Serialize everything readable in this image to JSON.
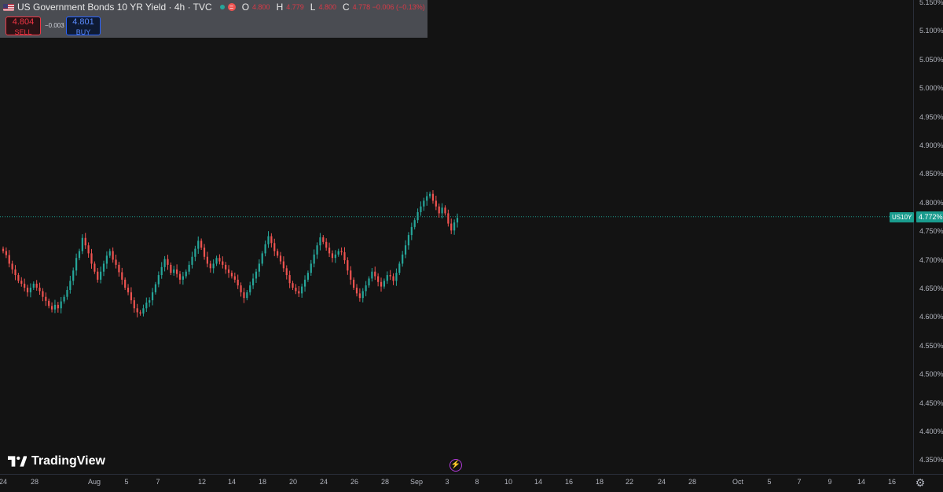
{
  "legend": {
    "symbol_title": "US Government Bonds 10 YR Yield · 4h · TVC",
    "open_key": "O",
    "open_val": "4.800",
    "high_key": "H",
    "high_val": "4.779",
    "low_key": "L",
    "low_val": "4.800",
    "close_key": "C",
    "close_val": "4.778 −0.006 (−0.13%)"
  },
  "trade": {
    "sell_price": "4.804",
    "sell_label": "SELL",
    "spread": "0.003",
    "buy_price": "4.801",
    "buy_label": "BUY"
  },
  "brand": {
    "name": "TradingView"
  },
  "colors": {
    "up": "#26a69a",
    "down": "#ef5350",
    "background": "#131313",
    "last_price": "#1a9c8e"
  },
  "icons": {
    "flag": "us-flag-icon",
    "bolt": "lightning-icon",
    "settings": "gear-icon"
  },
  "price_axis": {
    "labels": [
      "5.150%",
      "5.100%",
      "5.050%",
      "5.000%",
      "4.950%",
      "4.900%",
      "4.850%",
      "4.800%",
      "4.750%",
      "4.700%",
      "4.650%",
      "4.600%",
      "4.550%",
      "4.500%",
      "4.450%",
      "4.400%",
      "4.350%"
    ],
    "symbol_badge": "US10Y",
    "last_price": "4.772%"
  },
  "time_axis": {
    "labels": [
      "24",
      "28",
      "Aug",
      "5",
      "7",
      "12",
      "14",
      "18",
      "20",
      "24",
      "26",
      "28",
      "Sep",
      "3",
      "8",
      "10",
      "14",
      "16",
      "18",
      "22",
      "24",
      "28",
      "Oct",
      "5",
      "7",
      "9",
      "14",
      "16"
    ]
  },
  "chart_data": {
    "type": "candlestick",
    "y_unit": "%",
    "ylim": [
      4.33,
      5.16
    ],
    "grid": false,
    "last_price": 4.772,
    "series": [
      {
        "values": [
          4.712,
          4.705,
          4.69,
          4.68,
          4.67,
          4.66,
          4.655,
          4.648,
          4.64,
          4.648,
          4.655,
          4.648,
          4.642,
          4.632,
          4.625,
          4.616,
          4.61,
          4.618,
          4.612,
          4.624,
          4.632,
          4.644,
          4.66,
          4.678,
          4.7,
          4.712,
          4.735,
          4.722,
          4.708,
          4.69,
          4.676,
          4.662,
          4.676,
          4.69,
          4.704,
          4.712,
          4.697,
          4.688,
          4.675,
          4.662,
          4.648,
          4.64,
          4.626,
          4.612,
          4.605,
          4.603,
          4.612,
          4.622,
          4.626,
          4.64,
          4.654,
          4.67,
          4.684,
          4.698,
          4.688,
          4.674,
          4.68,
          4.672,
          4.662,
          4.668,
          4.676,
          4.688,
          4.702,
          4.716,
          4.73,
          4.718,
          4.702,
          4.69,
          4.682,
          4.69,
          4.7,
          4.694,
          4.688,
          4.68,
          4.674,
          4.668,
          4.662,
          4.652,
          4.64,
          4.63,
          4.64,
          4.652,
          4.664,
          4.676,
          4.69,
          4.708,
          4.724,
          4.738,
          4.726,
          4.712,
          4.704,
          4.694,
          4.682,
          4.67,
          4.656,
          4.648,
          4.642,
          4.638,
          4.65,
          4.662,
          4.674,
          4.69,
          4.706,
          4.722,
          4.736,
          4.728,
          4.718,
          4.708,
          4.7,
          4.706,
          4.712,
          4.71,
          4.696,
          4.678,
          4.662,
          4.648,
          4.638,
          4.63,
          4.642,
          4.652,
          4.664,
          4.676,
          4.668,
          4.658,
          4.65,
          4.66,
          4.67,
          4.668,
          4.66,
          4.674,
          4.69,
          4.706,
          4.722,
          4.74,
          4.754,
          4.766,
          4.78,
          4.79,
          4.8,
          4.808,
          4.812,
          4.8,
          4.79,
          4.778,
          4.788,
          4.778,
          4.76,
          4.748,
          4.762,
          4.77
        ]
      }
    ]
  }
}
